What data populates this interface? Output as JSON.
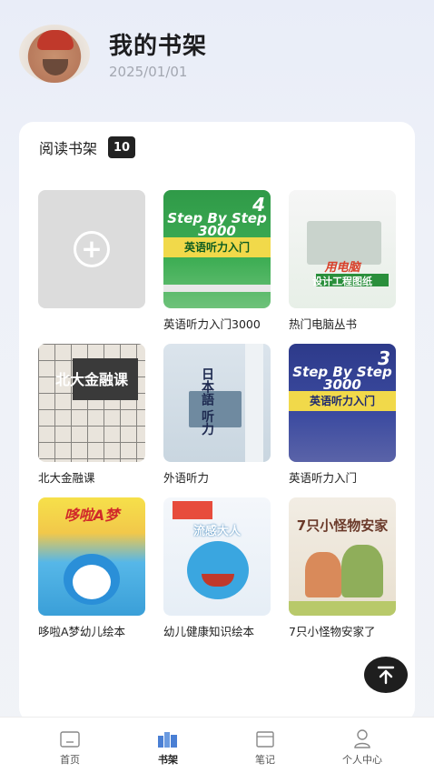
{
  "header": {
    "title": "我的书架",
    "date": "2025/01/01"
  },
  "shelf": {
    "title": "阅读书架",
    "count": "10",
    "books": [
      {
        "title": "",
        "type": "add"
      },
      {
        "title": "英语听力入门3000",
        "cover_text": "Step By Step 3000",
        "cover_sub": "英语听力入门",
        "cover_num": "4"
      },
      {
        "title": "热门电脑丛书",
        "cover_text": "用电脑",
        "cover_sub": "设计工程图纸"
      },
      {
        "title": "北大金融课",
        "cover_text": "北大金融课"
      },
      {
        "title": "外语听力",
        "cover_text": "日本語 听力"
      },
      {
        "title": "英语听力入门",
        "cover_text": "Step By Step 3000",
        "cover_sub": "英语听力入门",
        "cover_num": "3"
      },
      {
        "title": "哆啦A梦幼儿绘本",
        "cover_text": "哆啦A梦"
      },
      {
        "title": "幼儿健康知识绘本",
        "cover_text": "流感大人"
      },
      {
        "title": "7只小怪物安家了",
        "cover_text": "7只小怪物安家"
      }
    ]
  },
  "tabbar": {
    "items": [
      {
        "label": "首页",
        "icon": "home-icon"
      },
      {
        "label": "书架",
        "icon": "bookshelf-icon"
      },
      {
        "label": "笔记",
        "icon": "note-icon"
      },
      {
        "label": "个人中心",
        "icon": "person-icon"
      }
    ],
    "active": "书架"
  },
  "colors": {
    "accent": "#1e1e1e",
    "active_tab_icon": "#4a7fd4"
  }
}
